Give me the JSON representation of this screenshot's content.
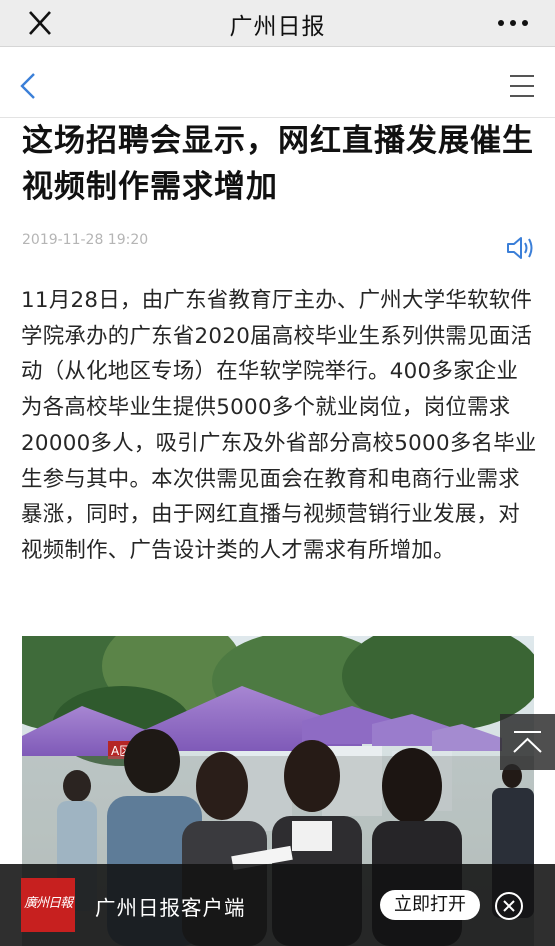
{
  "top_bar": {
    "title": "广州日报",
    "close_icon": "close-icon",
    "more_icon": "more-dots-icon"
  },
  "nav": {
    "back_icon": "chevron-left-icon",
    "menu_icon": "menu-icon"
  },
  "article": {
    "headline": "这场招聘会显示，网红直播发展催生视频制作需求增加",
    "date": "2019-11-28 19:20",
    "audio_icon": "speaker-icon",
    "body": "11月28日，由广东省教育厅主办、广州大学华软软件学院承办的广东省2020届高校毕业生系列供需见面活动（从化地区专场）在华软学院举行。400多家企业为各高校毕业生提供5000多个就业岗位，岗位需求20000多人，吸引广东及外省部分高校5000多名毕业生参与其中。本次供需见面会在教育和电商行业需求暴涨，同时，由于网红直播与视频营销行业发展，对视频制作、广告设计类的人才需求有所增加。"
  },
  "photo": {
    "booth_sign": "A区"
  },
  "scroll_top_icon": "arrow-up-icon",
  "app_banner": {
    "logo_text": "廣州日報",
    "name": "广州日报客户端",
    "open_label": "立即打开",
    "close_icon": "close-circle-icon"
  },
  "colors": {
    "link_blue": "#3b7fd8",
    "banner_red": "#c7201f",
    "top_bar_bg": "#ededed"
  }
}
